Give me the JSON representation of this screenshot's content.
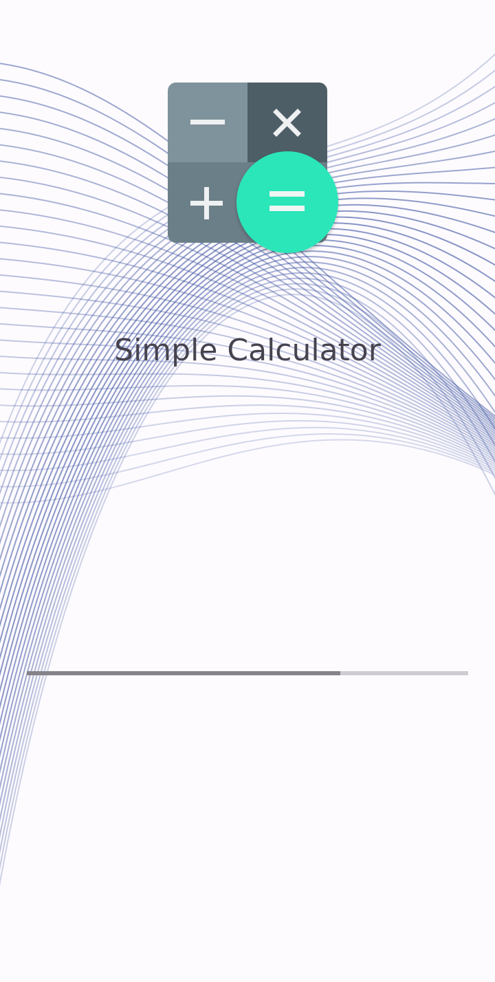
{
  "app": {
    "title": "Simple Calculator"
  },
  "logo": {
    "icons": [
      "minus-icon",
      "multiply-icon",
      "plus-icon",
      "equals-icon"
    ],
    "colors": {
      "tile_top_left": "#7f939c",
      "tile_top_right": "#4e5e66",
      "tile_bottom": "#6b7f88",
      "equals_circle": "#29e6b9"
    }
  },
  "loading": {
    "progress": 0.71,
    "track_color": "#cfcbd2",
    "fill_color": "#858289"
  },
  "background": {
    "line_color": "#3b52a0"
  }
}
